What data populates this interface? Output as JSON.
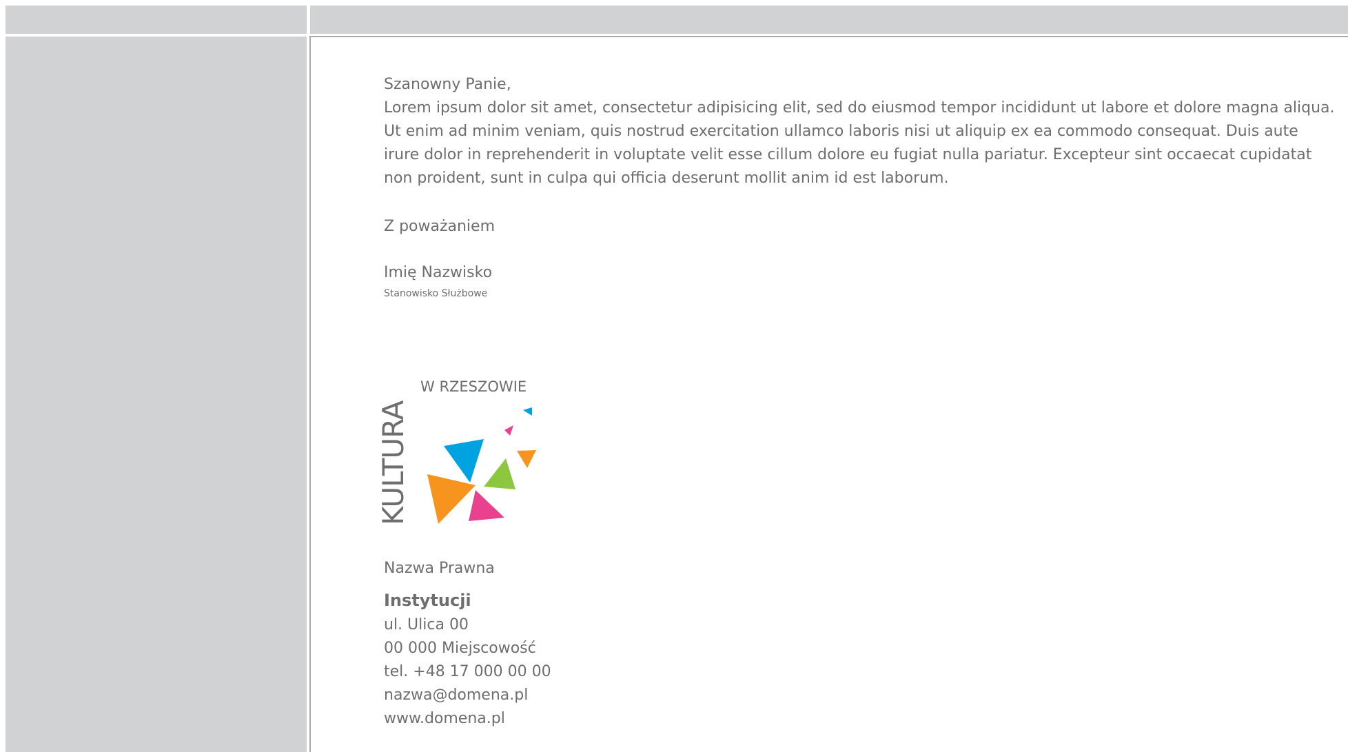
{
  "letter": {
    "greeting": "Szanowny Panie,",
    "body": "Lorem ipsum dolor sit amet, consectetur adipisicing elit, sed do eiusmod tempor incididunt ut labore et dolore magna aliqua. Ut enim ad minim veniam, quis nostrud exercitation ullamco laboris nisi ut aliquip ex ea commodo consequat. Duis aute irure dolor in reprehenderit in voluptate velit esse cillum dolore eu fugiat nulla pariatur. Excepteur sint occaecat cupidatat non proident, sunt in culpa qui officia deserunt mollit anim id est laborum.",
    "closing": "Z poważaniem",
    "signer_name": "Imię Nazwisko",
    "signer_position": "Stanowisko Służbowe"
  },
  "logo": {
    "vertical_text": "KULTURA",
    "top_text": "W RZESZOWIE",
    "colors": {
      "blue": "#00a3e0",
      "pink": "#e9418d",
      "orange": "#f7941d",
      "green": "#8dc63f",
      "text": "#6d6e70"
    }
  },
  "footer": {
    "legal_name": "Nazwa Prawna",
    "institution": "Instytucji",
    "street": "ul. Ulica 00",
    "city": "00 000 Miejscowość",
    "phone": "tel. +48 17 000 00 00",
    "email": "nazwa@domena.pl",
    "website": "www.domena.pl"
  },
  "colors": {
    "frame": "#d1d2d4",
    "border": "#a7a9ac",
    "text": "#6d6e70"
  }
}
